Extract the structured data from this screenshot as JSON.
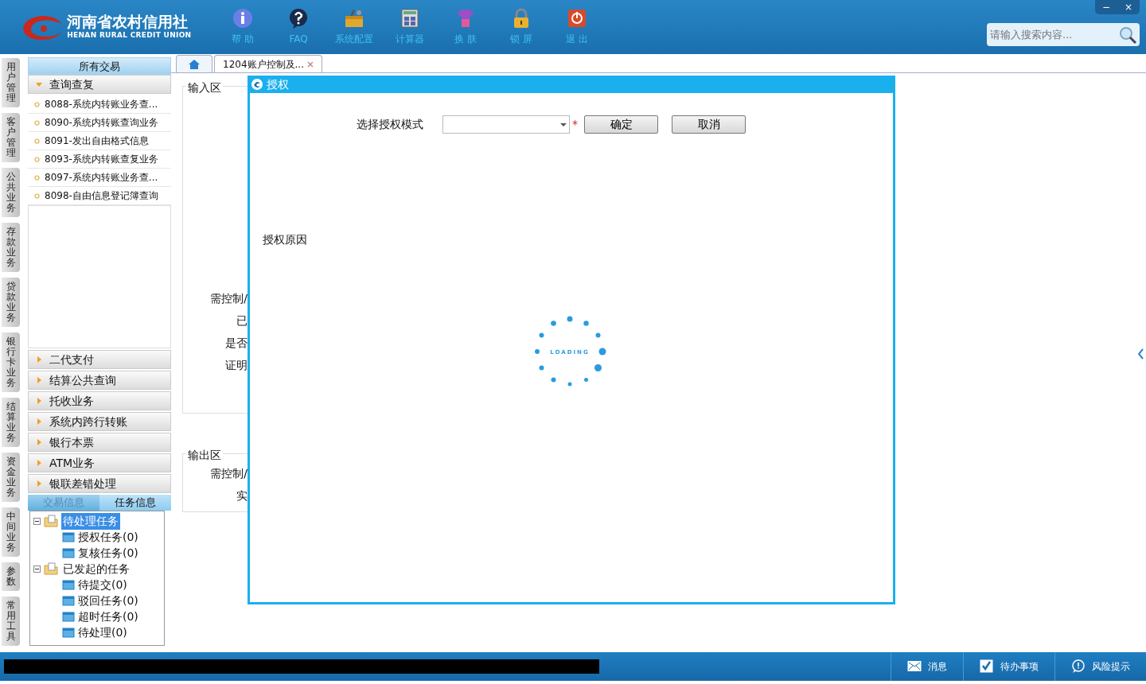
{
  "header": {
    "logo_title": "河南省农村信用社",
    "logo_subtitle": "HENAN RURAL CREDIT UNION",
    "nav": [
      {
        "label": "帮 助",
        "kind": "info"
      },
      {
        "label": "FAQ",
        "kind": "faq"
      },
      {
        "label": "系统配置",
        "kind": "toolbox"
      },
      {
        "label": "计算器",
        "kind": "calculator"
      },
      {
        "label": "换 肤",
        "kind": "skin"
      },
      {
        "label": "锁 屏",
        "kind": "lock"
      },
      {
        "label": "退 出",
        "kind": "exit"
      }
    ],
    "window_controls": [
      "−",
      "×"
    ],
    "search": {
      "placeholder": "请输入搜索内容..."
    }
  },
  "left_tabs": [
    "用户管理",
    "客户管理",
    "公共业务",
    "存款业务",
    "贷款业务",
    "银行卡业务",
    "结算业务",
    "资金业务",
    "中间业务",
    "参数",
    "常用工具"
  ],
  "sidebar": {
    "title": "所有交易",
    "groups": [
      {
        "label": "查询查复",
        "expanded": true,
        "items": [
          "8088-系统内转账业务查...",
          "8090-系统内转账查询业务",
          "8091-发出自由格式信息",
          "8093-系统内转账查复业务",
          "8097-系统内转账业务查...",
          "8098-自由信息登记簿查询"
        ]
      },
      {
        "label": "二代支付",
        "expanded": false
      },
      {
        "label": "结算公共查询",
        "expanded": false
      },
      {
        "label": "托收业务",
        "expanded": false
      },
      {
        "label": "系统内跨行转账",
        "expanded": false
      },
      {
        "label": "银行本票",
        "expanded": false
      },
      {
        "label": "ATM业务",
        "expanded": false
      },
      {
        "label": "银联差错处理",
        "expanded": false
      }
    ],
    "panel_tabs": [
      {
        "label": "交易信息",
        "selected": false
      },
      {
        "label": "任务信息",
        "selected": true
      }
    ],
    "tree": [
      {
        "label": "待处理任务",
        "expanded": true,
        "selected": true,
        "children": [
          {
            "label": "授权任务(0)",
            "selected": false
          },
          {
            "label": "复核任务(0)",
            "selected": false
          }
        ]
      },
      {
        "label": "已发起的任务",
        "expanded": true,
        "selected": false,
        "children": [
          {
            "label": "待提交(0)",
            "selected": false
          },
          {
            "label": "驳回任务(0)",
            "selected": false
          },
          {
            "label": "超时任务(0)",
            "selected": false
          },
          {
            "label": "待处理(0)",
            "selected": false
          }
        ]
      }
    ]
  },
  "doc_tabs": [
    {
      "kind": "home",
      "selected": false
    },
    {
      "kind": "page",
      "label": "1204账户控制及...",
      "selected": true
    }
  ],
  "form": {
    "sections": [
      {
        "title": "输入区",
        "kind": "input",
        "labels": [
          "需控制/",
          "已",
          "是否",
          "证明"
        ]
      },
      {
        "title": "输出区",
        "kind": "output",
        "labels": [
          "需控制/",
          "实"
        ]
      }
    ]
  },
  "dialog": {
    "title": "授权",
    "mode_label": "选择授权模式",
    "required_mark": "*",
    "buttons": [
      "确定",
      "取消"
    ],
    "reason_label": "授权原因",
    "loading_text": "LOADING"
  },
  "status_bar": {
    "items": [
      {
        "label": "消息",
        "kind": "mail"
      },
      {
        "label": "待办事项",
        "kind": "check"
      },
      {
        "label": "风险提示",
        "kind": "alert"
      }
    ]
  }
}
